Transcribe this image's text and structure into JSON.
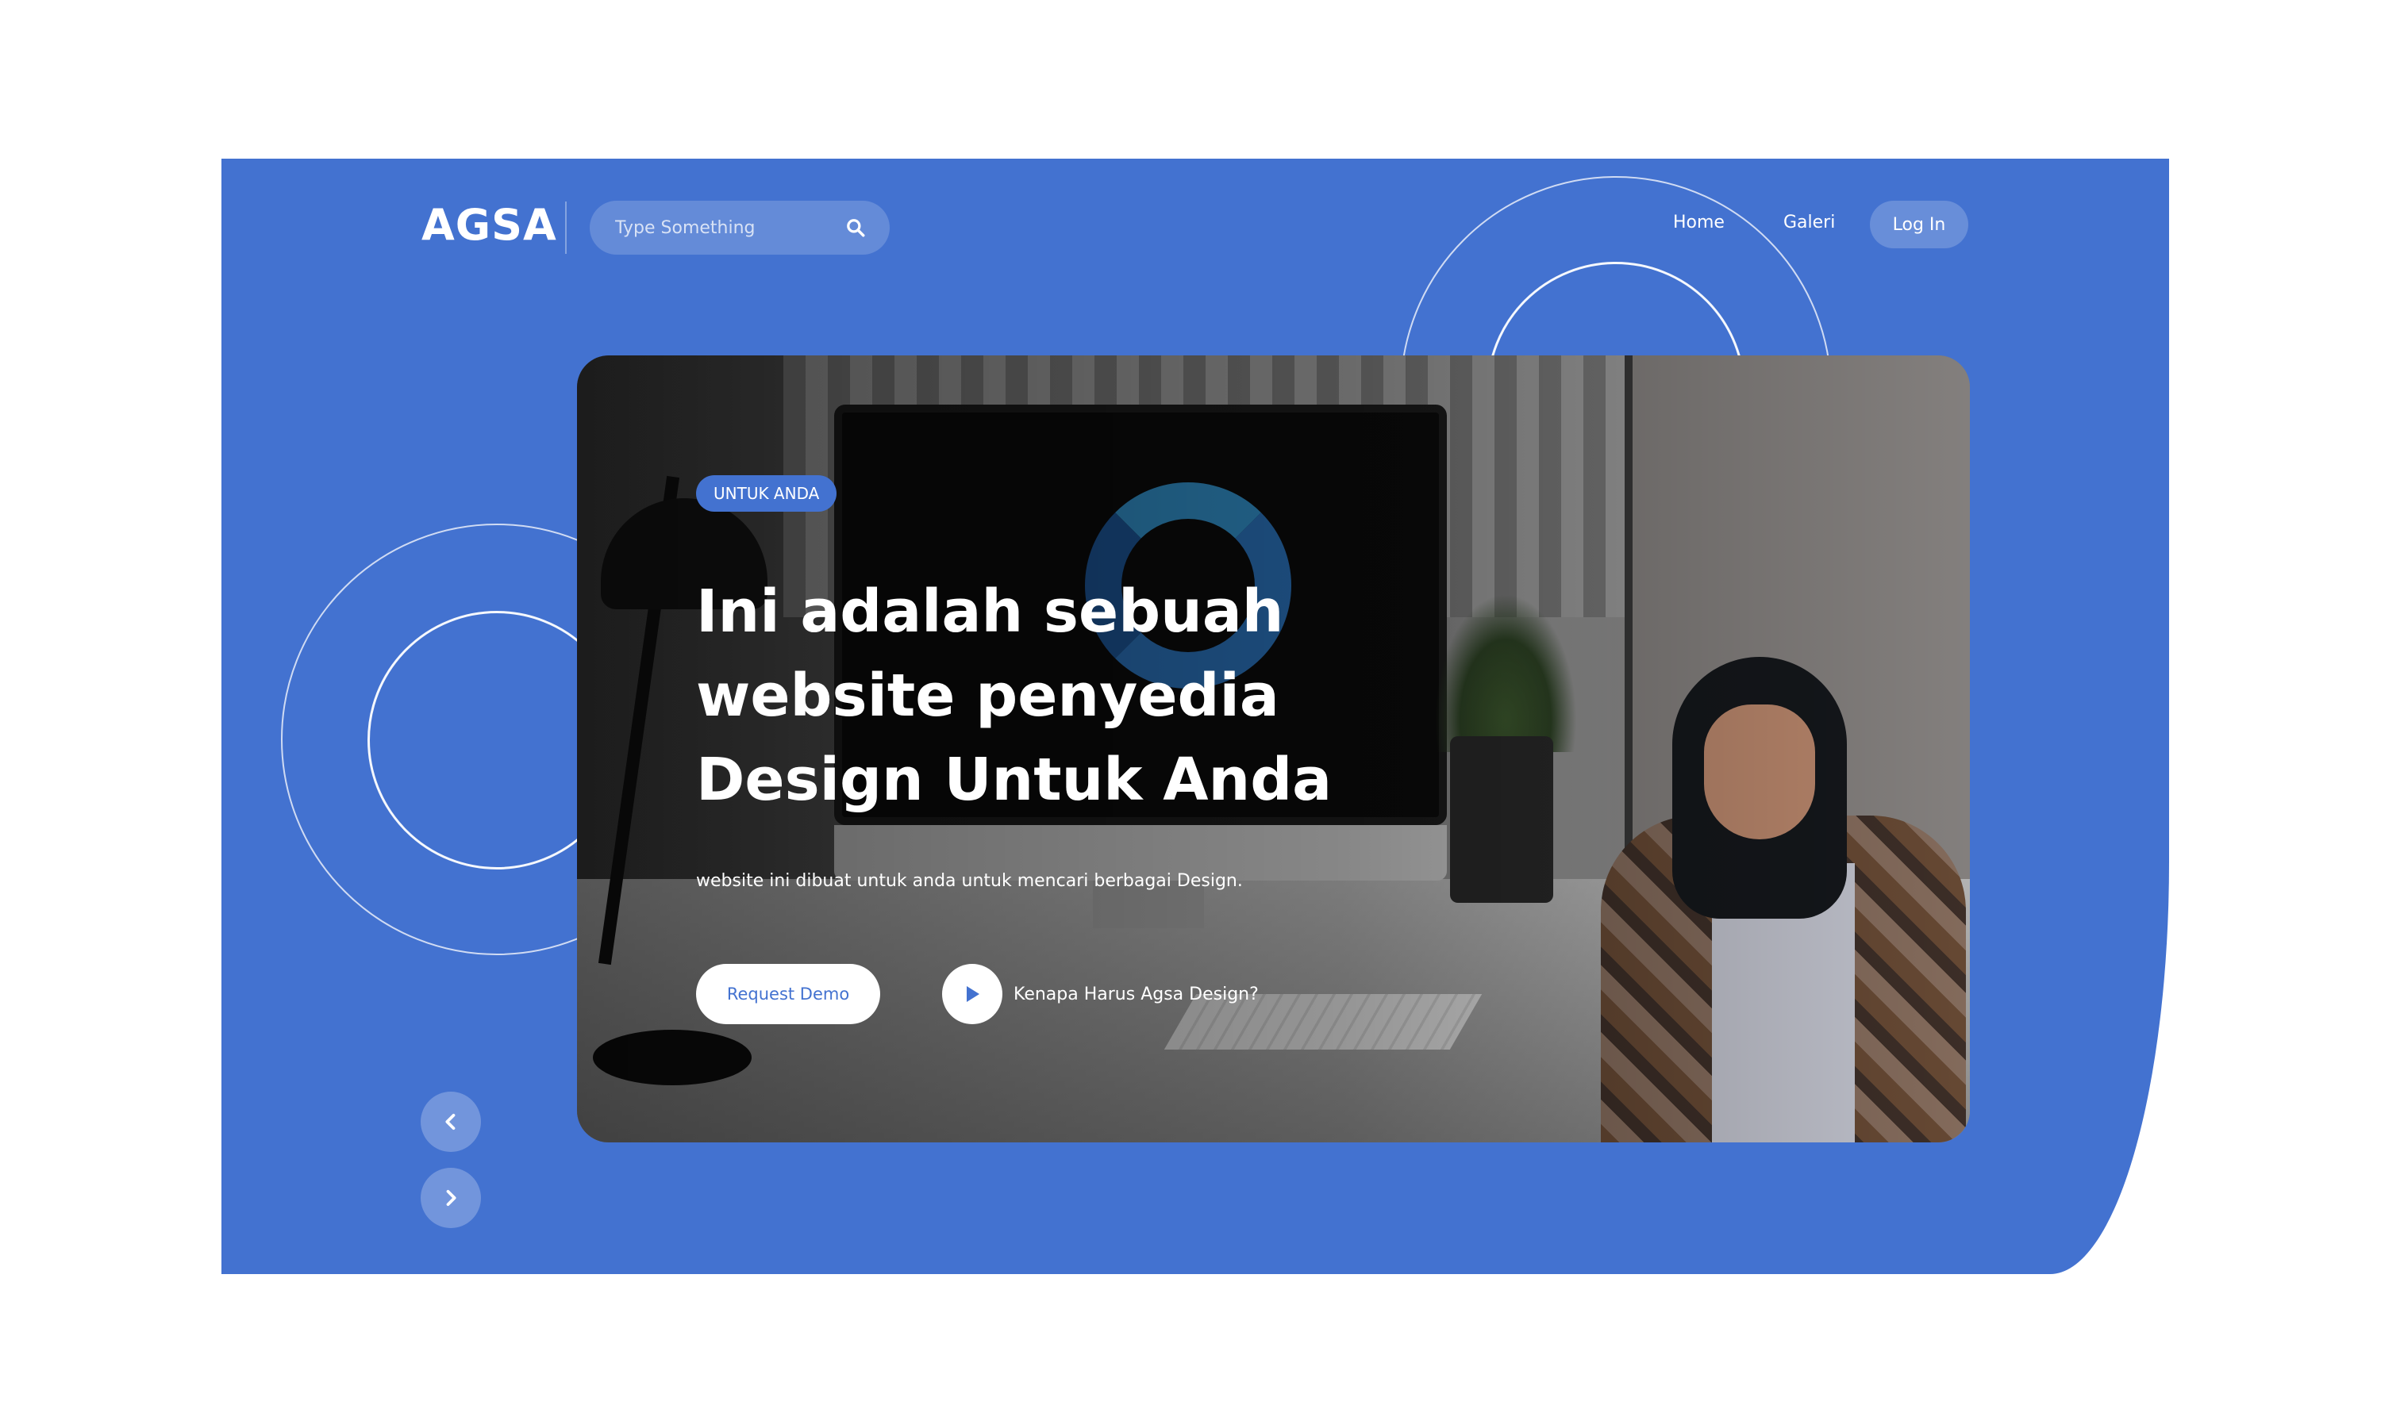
{
  "colors": {
    "brand": "#4372d0"
  },
  "header": {
    "logo": "AGSA",
    "search": {
      "placeholder": "Type Something",
      "icon": "search-icon"
    },
    "nav": [
      {
        "label": "Home"
      },
      {
        "label": "Galeri"
      }
    ],
    "login_label": "Log In"
  },
  "hero": {
    "badge": "UNTUK ANDA",
    "headline_lines": [
      "Ini adalah sebuah",
      "website penyedia",
      "Design Untuk Anda"
    ],
    "subtext": "website ini dibuat untuk anda untuk mencari berbagai Design.",
    "primary_button": "Request Demo",
    "secondary_link": "Kenapa Harus Agsa Design?"
  },
  "carousel": {
    "prev_icon": "chevron-left-icon",
    "next_icon": "chevron-right-icon"
  }
}
